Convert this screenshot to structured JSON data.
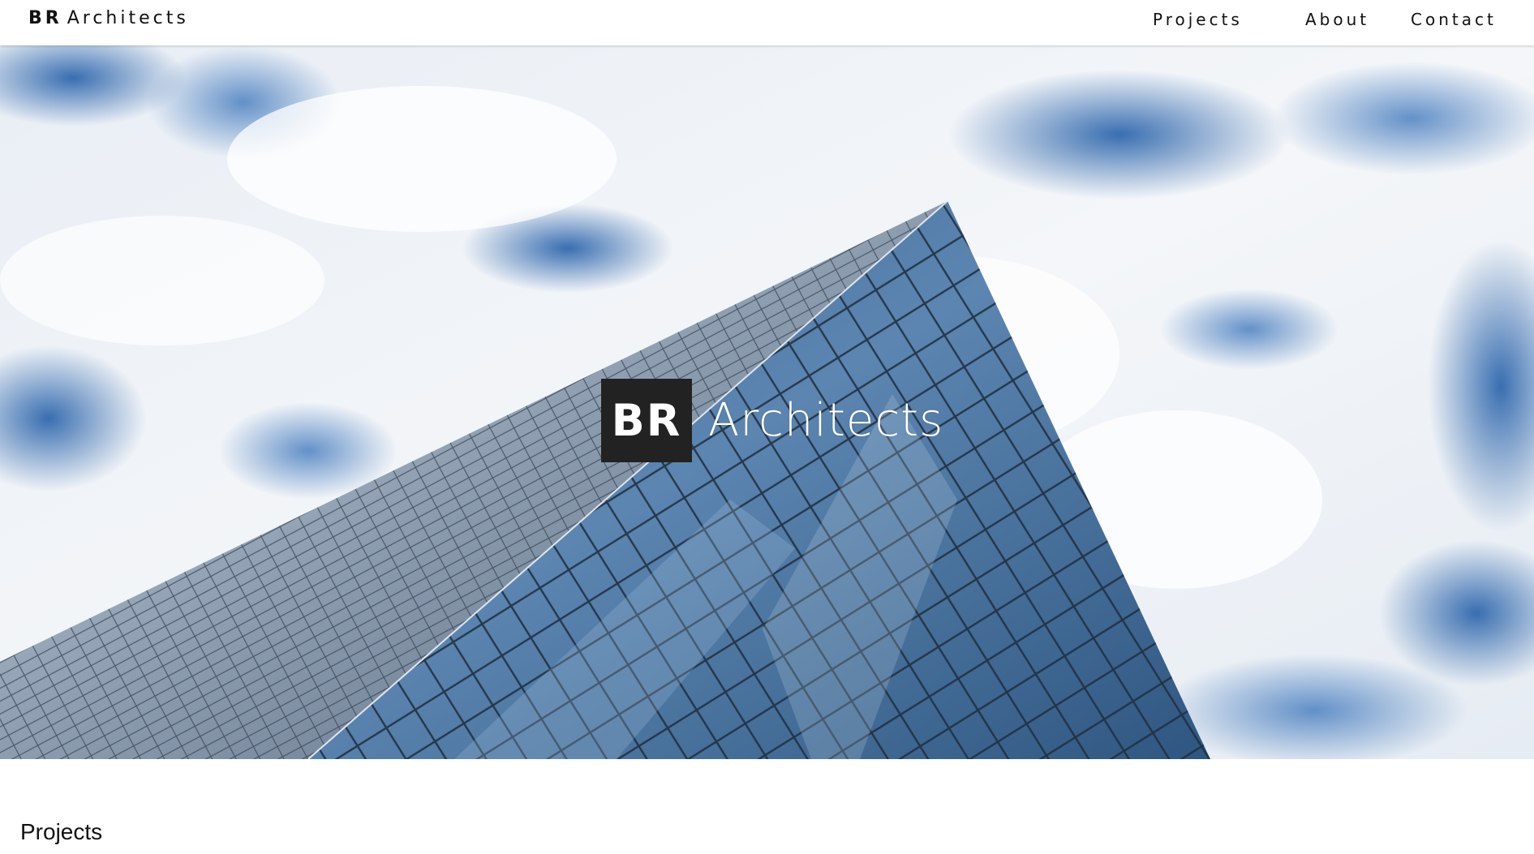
{
  "header": {
    "brand_bold": "BR",
    "brand_text": "Architects",
    "nav": [
      {
        "label": "Projects"
      },
      {
        "label": "About"
      },
      {
        "label": "Contact"
      }
    ]
  },
  "hero": {
    "logo_box": "BR",
    "logo_word": "Architects",
    "image": "skyscraper-glass-facade-clouds-photo"
  },
  "projects": {
    "title": "Projects"
  },
  "colors": {
    "logo_box": "#222222",
    "sky": "#3d73b5",
    "glass": "#4f78a0"
  }
}
